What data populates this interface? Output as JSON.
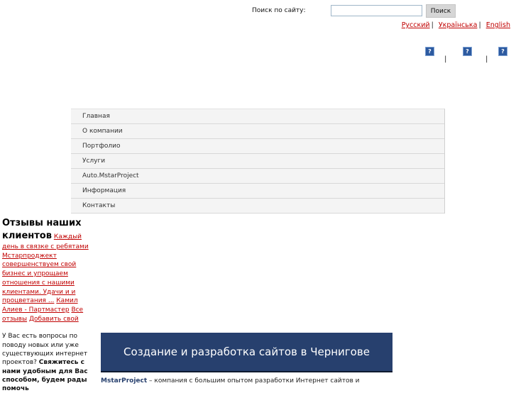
{
  "search": {
    "label": "Поиск по сайту:",
    "value": "",
    "button": "Поиск"
  },
  "languages": [
    "Русский",
    "Українська",
    "English"
  ],
  "language_separator": "|",
  "help_icon_glyph": "?",
  "nav": [
    "Главная",
    "О компании",
    "Портфолио",
    "Услуги",
    "Auto.MstarProject",
    "Информация",
    "Контакты"
  ],
  "reviews": {
    "title": "Отзывы наших клиентов",
    "quote": "Каждый день в связке с ребятами Мстарпроджект совершенствуем свой бизнес и упрощаем отношения с нашими клиентами. Удачи и и процветания ...",
    "author": "Камил Алиев - Партмастер",
    "all_link": "Все отзывы",
    "add_link": "Добавить свой"
  },
  "question": {
    "text": "У Вас есть вопросы по поводу новых или уже существующих интернет проектов?",
    "bold": "Свяжитесь с нами удобным для Вас способом, будем рады помочь"
  },
  "hero": {
    "title": "Создание и разработка сайтов в Чернигове"
  },
  "intro": {
    "brand": "MstarProject",
    "text": " – компания с большим опытом разработки Интернет сайтов и"
  },
  "colors": {
    "link": "#c00000",
    "hero_bg": "#27406e",
    "help_icon": "#2c5aa0"
  }
}
